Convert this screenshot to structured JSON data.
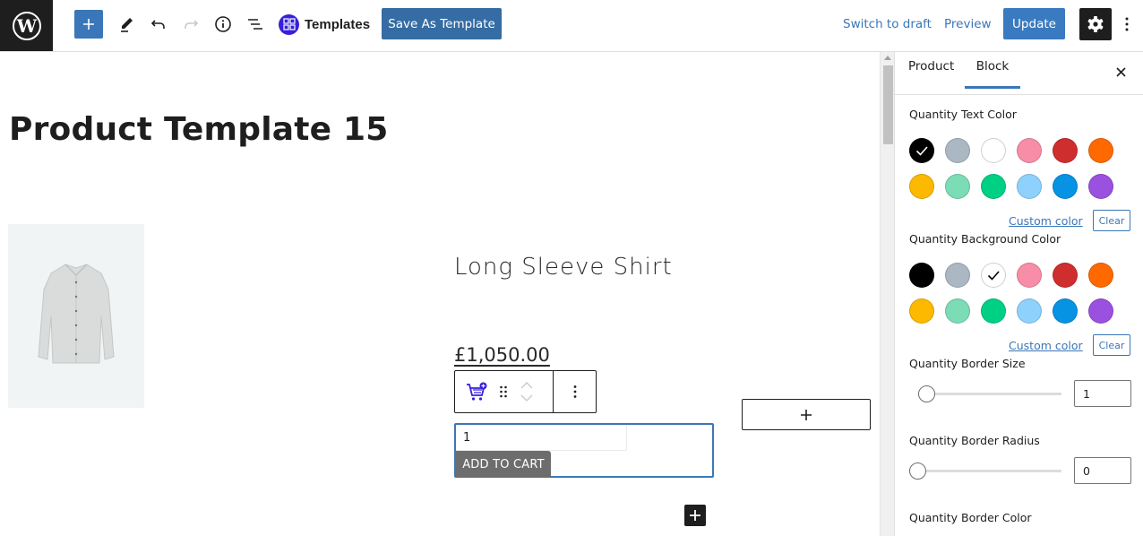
{
  "topbar": {
    "inserter_icon": "plus-icon",
    "tools_icon": "pencil-icon",
    "undo_icon": "undo-icon",
    "redo_icon": "redo-icon",
    "info_icon": "info-icon",
    "list_view_icon": "list-view-icon",
    "templates_label": "Templates",
    "save_template_label": "Save As Template",
    "switch_draft_label": "Switch to draft",
    "preview_label": "Preview",
    "update_label": "Update",
    "settings_icon": "gear-icon",
    "more_icon": "more-vertical-icon"
  },
  "canvas": {
    "post_title": "Product Template 15",
    "product_name": "Long Sleeve Shirt",
    "price": "£1,050.00",
    "quantity_value": "1",
    "add_to_cart_label": "ADD TO CART",
    "block_toolbar": {
      "block_icon": "add-to-cart-icon",
      "drag_icon": "drag-handle-icon",
      "move_icon": "move-up-down-icon",
      "options_icon": "more-vertical-icon"
    },
    "appender_label": "+",
    "mini_add_label": "+"
  },
  "sidebar": {
    "tabs": [
      {
        "label": "Product",
        "active": false
      },
      {
        "label": "Block",
        "active": true
      }
    ],
    "close_icon": "close-icon",
    "text_color": {
      "label": "Quantity Text Color",
      "selected": "#000000",
      "custom_label": "Custom color",
      "clear_label": "Clear"
    },
    "background_color": {
      "label": "Quantity Background Color",
      "selected": "#ffffff",
      "custom_label": "Custom color",
      "clear_label": "Clear"
    },
    "palette": [
      "#000000",
      "#abb8c3",
      "#ffffff",
      "#f78da7",
      "#cf2e2e",
      "#ff6900",
      "#fcb900",
      "#7bdcb5",
      "#00d084",
      "#8ed1fc",
      "#0693e3",
      "#9b51e0"
    ],
    "border_size": {
      "label": "Quantity Border Size",
      "value": "1"
    },
    "border_radius": {
      "label": "Quantity Border Radius",
      "value": "0"
    },
    "border_color": {
      "label": "Quantity Border Color"
    }
  }
}
